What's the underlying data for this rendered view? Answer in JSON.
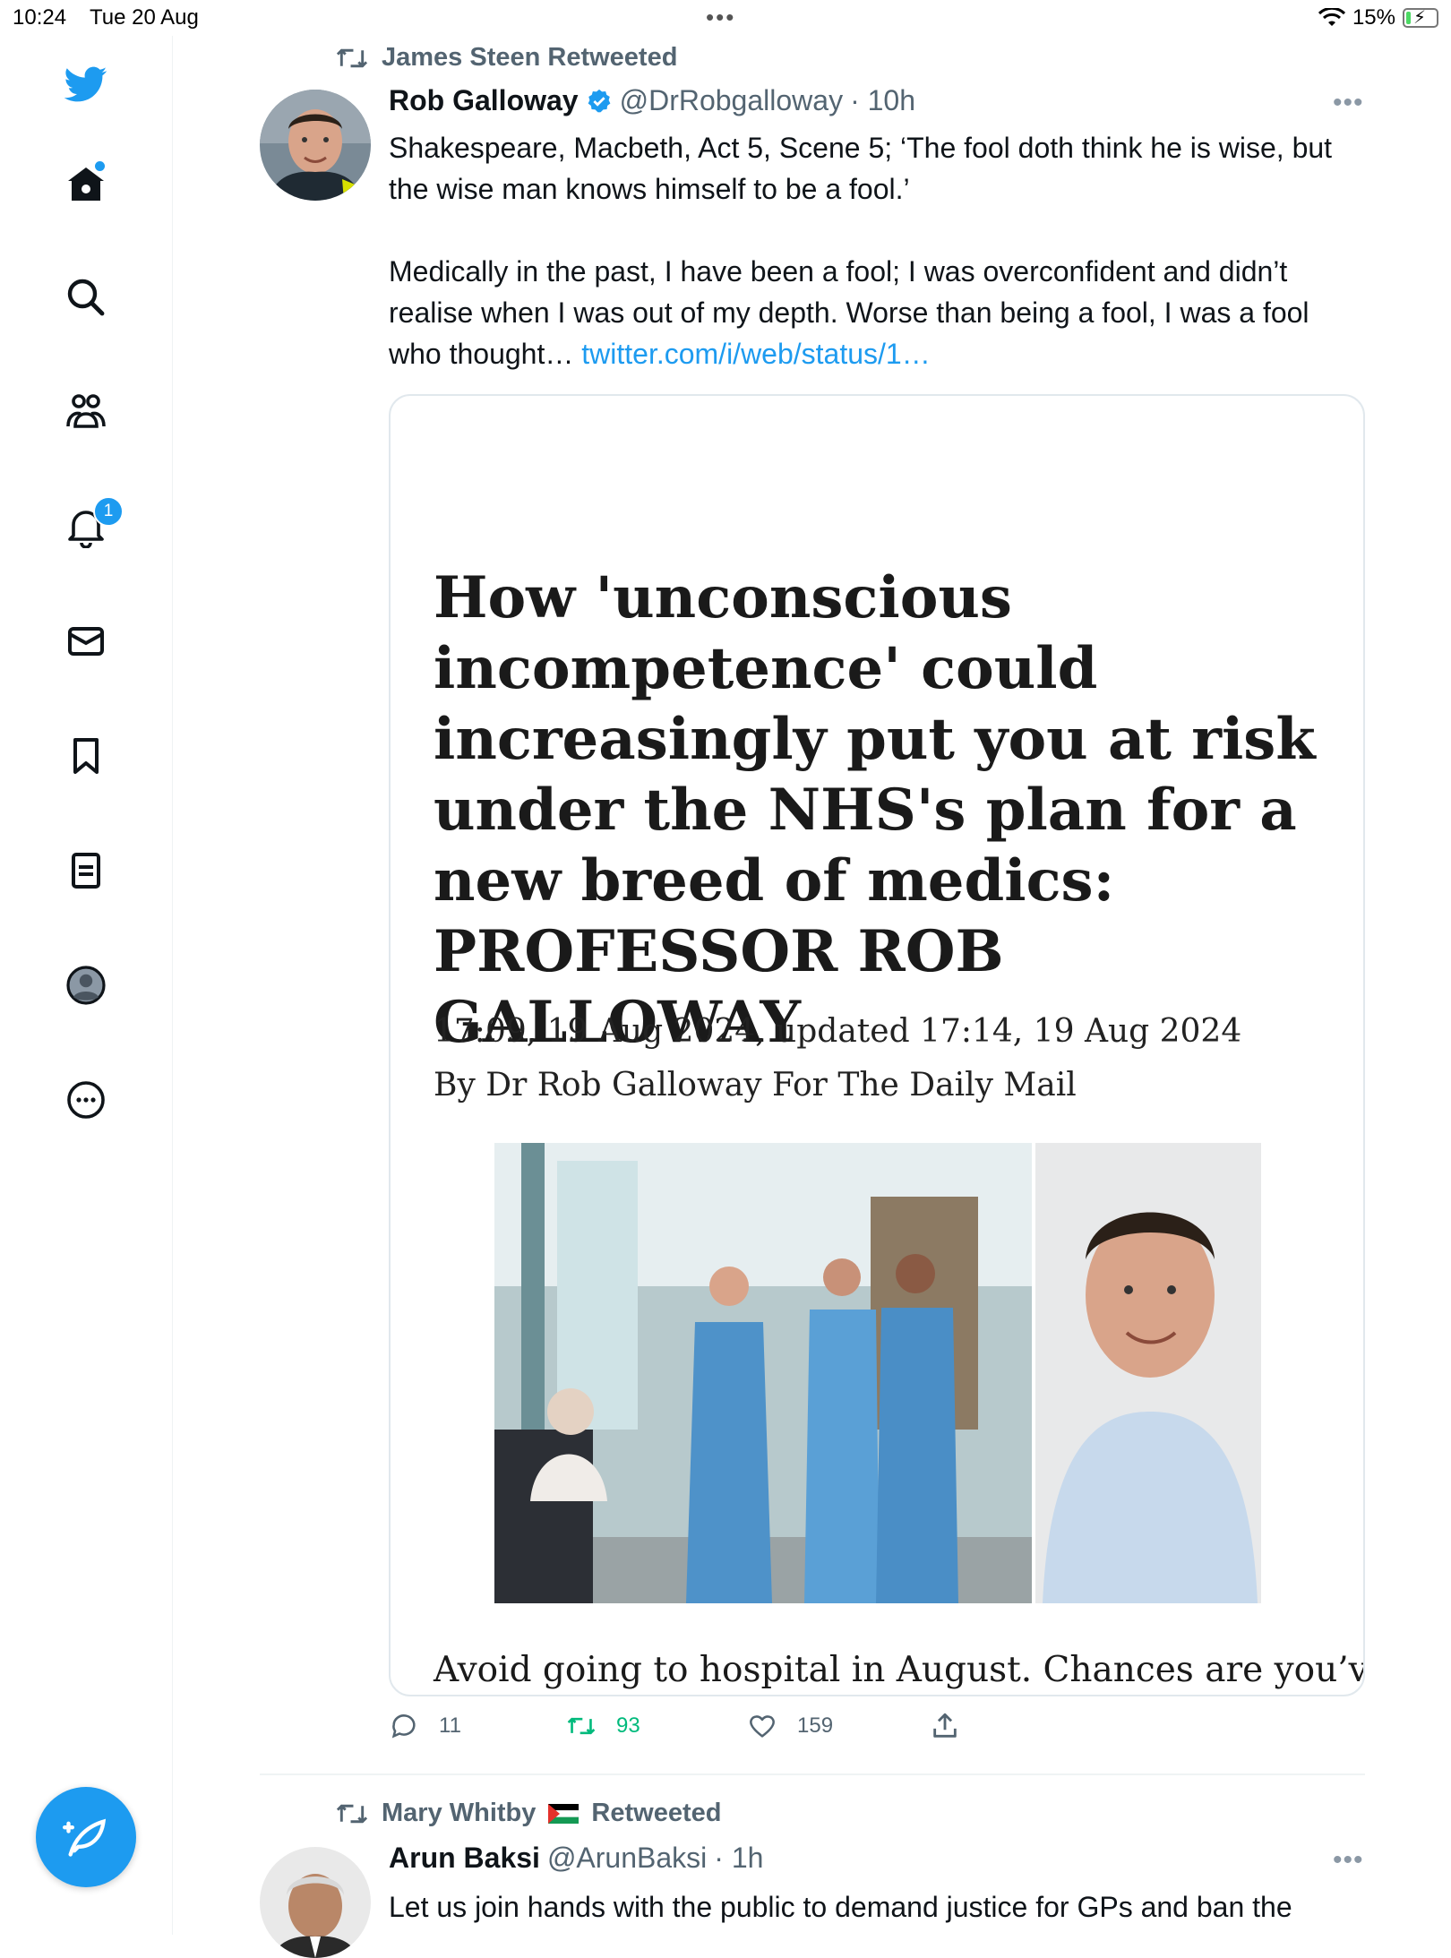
{
  "status_bar": {
    "time": "10:24",
    "date": "Tue 20 Aug",
    "battery_percent": "15%",
    "battery_level": 0.15
  },
  "sidebar": {
    "notification_count": "1",
    "accent_color": "#1d9bf0",
    "icons": [
      "twitter-bird-icon",
      "home-icon",
      "search-icon",
      "communities-icon",
      "notifications-icon",
      "messages-icon",
      "bookmarks-icon",
      "lists-icon",
      "profile-icon",
      "more-icon"
    ]
  },
  "tweet1": {
    "retweeted_by": "James Steen Retweeted",
    "name": "Rob Galloway",
    "handle": "@DrRobgalloway",
    "time": "· 10h",
    "text_p1": "Shakespeare, Macbeth, Act 5, Scene 5; ‘The fool doth think he is wise, but the wise man knows himself to be a fool.’",
    "text_p2": "Medically in the past, I  have been a fool; I was overconfident and didn’t realise when I was out of my depth. Worse than being a fool, I was a fool who thought…",
    "link": "twitter.com/i/web/status/1…",
    "card": {
      "title": "How 'unconscious incompetence' could increasingly put you at risk under the NHS's plan for a new breed of medics: PROFESSOR ROB GALLOWAY",
      "meta": "17:09, 19 Aug 2024, updated 17:14, 19 Aug 2024 By Dr Rob Galloway For The Daily Mail",
      "body": "Avoid going to hospital in August. Chances are you’ve"
    },
    "replies": "11",
    "retweets": "93",
    "likes": "159"
  },
  "tweet2": {
    "retweeted_by_name": "Mary Whitby",
    "retweeted_by_suffix": "Retweeted",
    "name": "Arun Baksi",
    "handle": "@ArunBaksi",
    "time": "· 1h",
    "text": "Let us join hands with the public to demand justice for GPs and ban the"
  }
}
